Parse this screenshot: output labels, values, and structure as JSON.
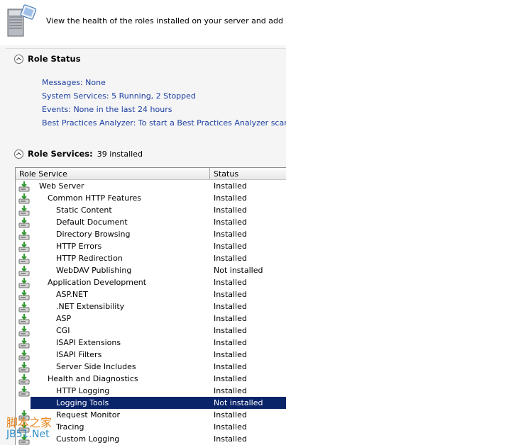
{
  "header": {
    "description": "View the health of the roles installed on your server and add or remove"
  },
  "role_status": {
    "title": "Role Status",
    "links": [
      "Messages: None",
      "System Services: 5 Running, 2 Stopped",
      "Events: None in the last 24 hours",
      "Best Practices Analyzer: To start a Best Practices Analyzer scan, go to t"
    ]
  },
  "role_services": {
    "title": "Role Services:",
    "count": "39 installed",
    "columns": [
      "Role Service",
      "Status"
    ],
    "rows": [
      {
        "name": "Web Server",
        "status": "Installed",
        "level": 0
      },
      {
        "name": "Common HTTP Features",
        "status": "Installed",
        "level": 1
      },
      {
        "name": "Static Content",
        "status": "Installed",
        "level": 2
      },
      {
        "name": "Default Document",
        "status": "Installed",
        "level": 2
      },
      {
        "name": "Directory Browsing",
        "status": "Installed",
        "level": 2
      },
      {
        "name": "HTTP Errors",
        "status": "Installed",
        "level": 2
      },
      {
        "name": "HTTP Redirection",
        "status": "Installed",
        "level": 2
      },
      {
        "name": "WebDAV Publishing",
        "status": "Not installed",
        "level": 2
      },
      {
        "name": "Application Development",
        "status": "Installed",
        "level": 1
      },
      {
        "name": "ASP.NET",
        "status": "Installed",
        "level": 2
      },
      {
        "name": ".NET Extensibility",
        "status": "Installed",
        "level": 2
      },
      {
        "name": "ASP",
        "status": "Installed",
        "level": 2
      },
      {
        "name": "CGI",
        "status": "Installed",
        "level": 2
      },
      {
        "name": "ISAPI Extensions",
        "status": "Installed",
        "level": 2
      },
      {
        "name": "ISAPI Filters",
        "status": "Installed",
        "level": 2
      },
      {
        "name": "Server Side Includes",
        "status": "Installed",
        "level": 2
      },
      {
        "name": "Health and Diagnostics",
        "status": "Installed",
        "level": 1
      },
      {
        "name": "HTTP Logging",
        "status": "Installed",
        "level": 2
      },
      {
        "name": "Logging Tools",
        "status": "Not installed",
        "level": 2,
        "selected": true
      },
      {
        "name": "Request Monitor",
        "status": "Installed",
        "level": 2
      },
      {
        "name": "Tracing",
        "status": "Installed",
        "level": 2
      },
      {
        "name": "Custom Logging",
        "status": "Installed",
        "level": 2
      }
    ]
  },
  "watermark": {
    "cn": "脚本之家",
    "en": "JB51.Net"
  },
  "colors": {
    "link": "#1a3ea3",
    "selection": "#0a246a"
  },
  "icons": {
    "server": "server-icon",
    "collapse": "collapse-up-icon",
    "installed": "install-arrow-icon"
  }
}
